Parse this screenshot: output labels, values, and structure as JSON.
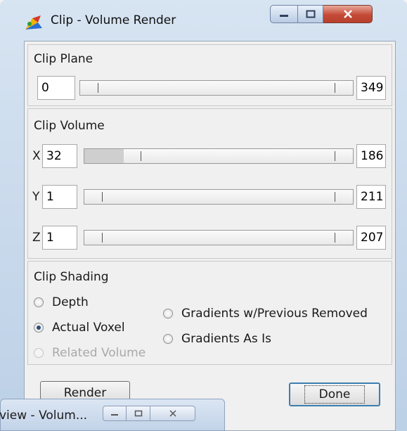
{
  "window": {
    "title": "Clip - Volume Render"
  },
  "clip_plane": {
    "title": "Clip Plane",
    "min_value": "0",
    "max_value": "349",
    "slider_level": 0.0
  },
  "clip_volume": {
    "title": "Clip Volume",
    "axes": [
      {
        "label": "X",
        "min_value": "32",
        "max_value": "186",
        "slider_level": 0.14
      },
      {
        "label": "Y",
        "min_value": "1",
        "max_value": "211",
        "slider_level": 0.0
      },
      {
        "label": "Z",
        "min_value": "1",
        "max_value": "207",
        "slider_level": 0.0
      }
    ]
  },
  "clip_shading": {
    "title": "Clip Shading",
    "options": [
      {
        "label": "Depth",
        "checked": false,
        "enabled": true
      },
      {
        "label": "Actual Voxel",
        "checked": true,
        "enabled": true
      },
      {
        "label": "Related Volume",
        "checked": false,
        "enabled": false
      },
      {
        "label": "Gradients w/Previous Removed",
        "checked": false,
        "enabled": true
      },
      {
        "label": "Gradients As Is",
        "checked": false,
        "enabled": true
      }
    ]
  },
  "buttons": {
    "render": "Render",
    "done": "Done"
  },
  "background_window": {
    "title": "view - Volum..."
  }
}
